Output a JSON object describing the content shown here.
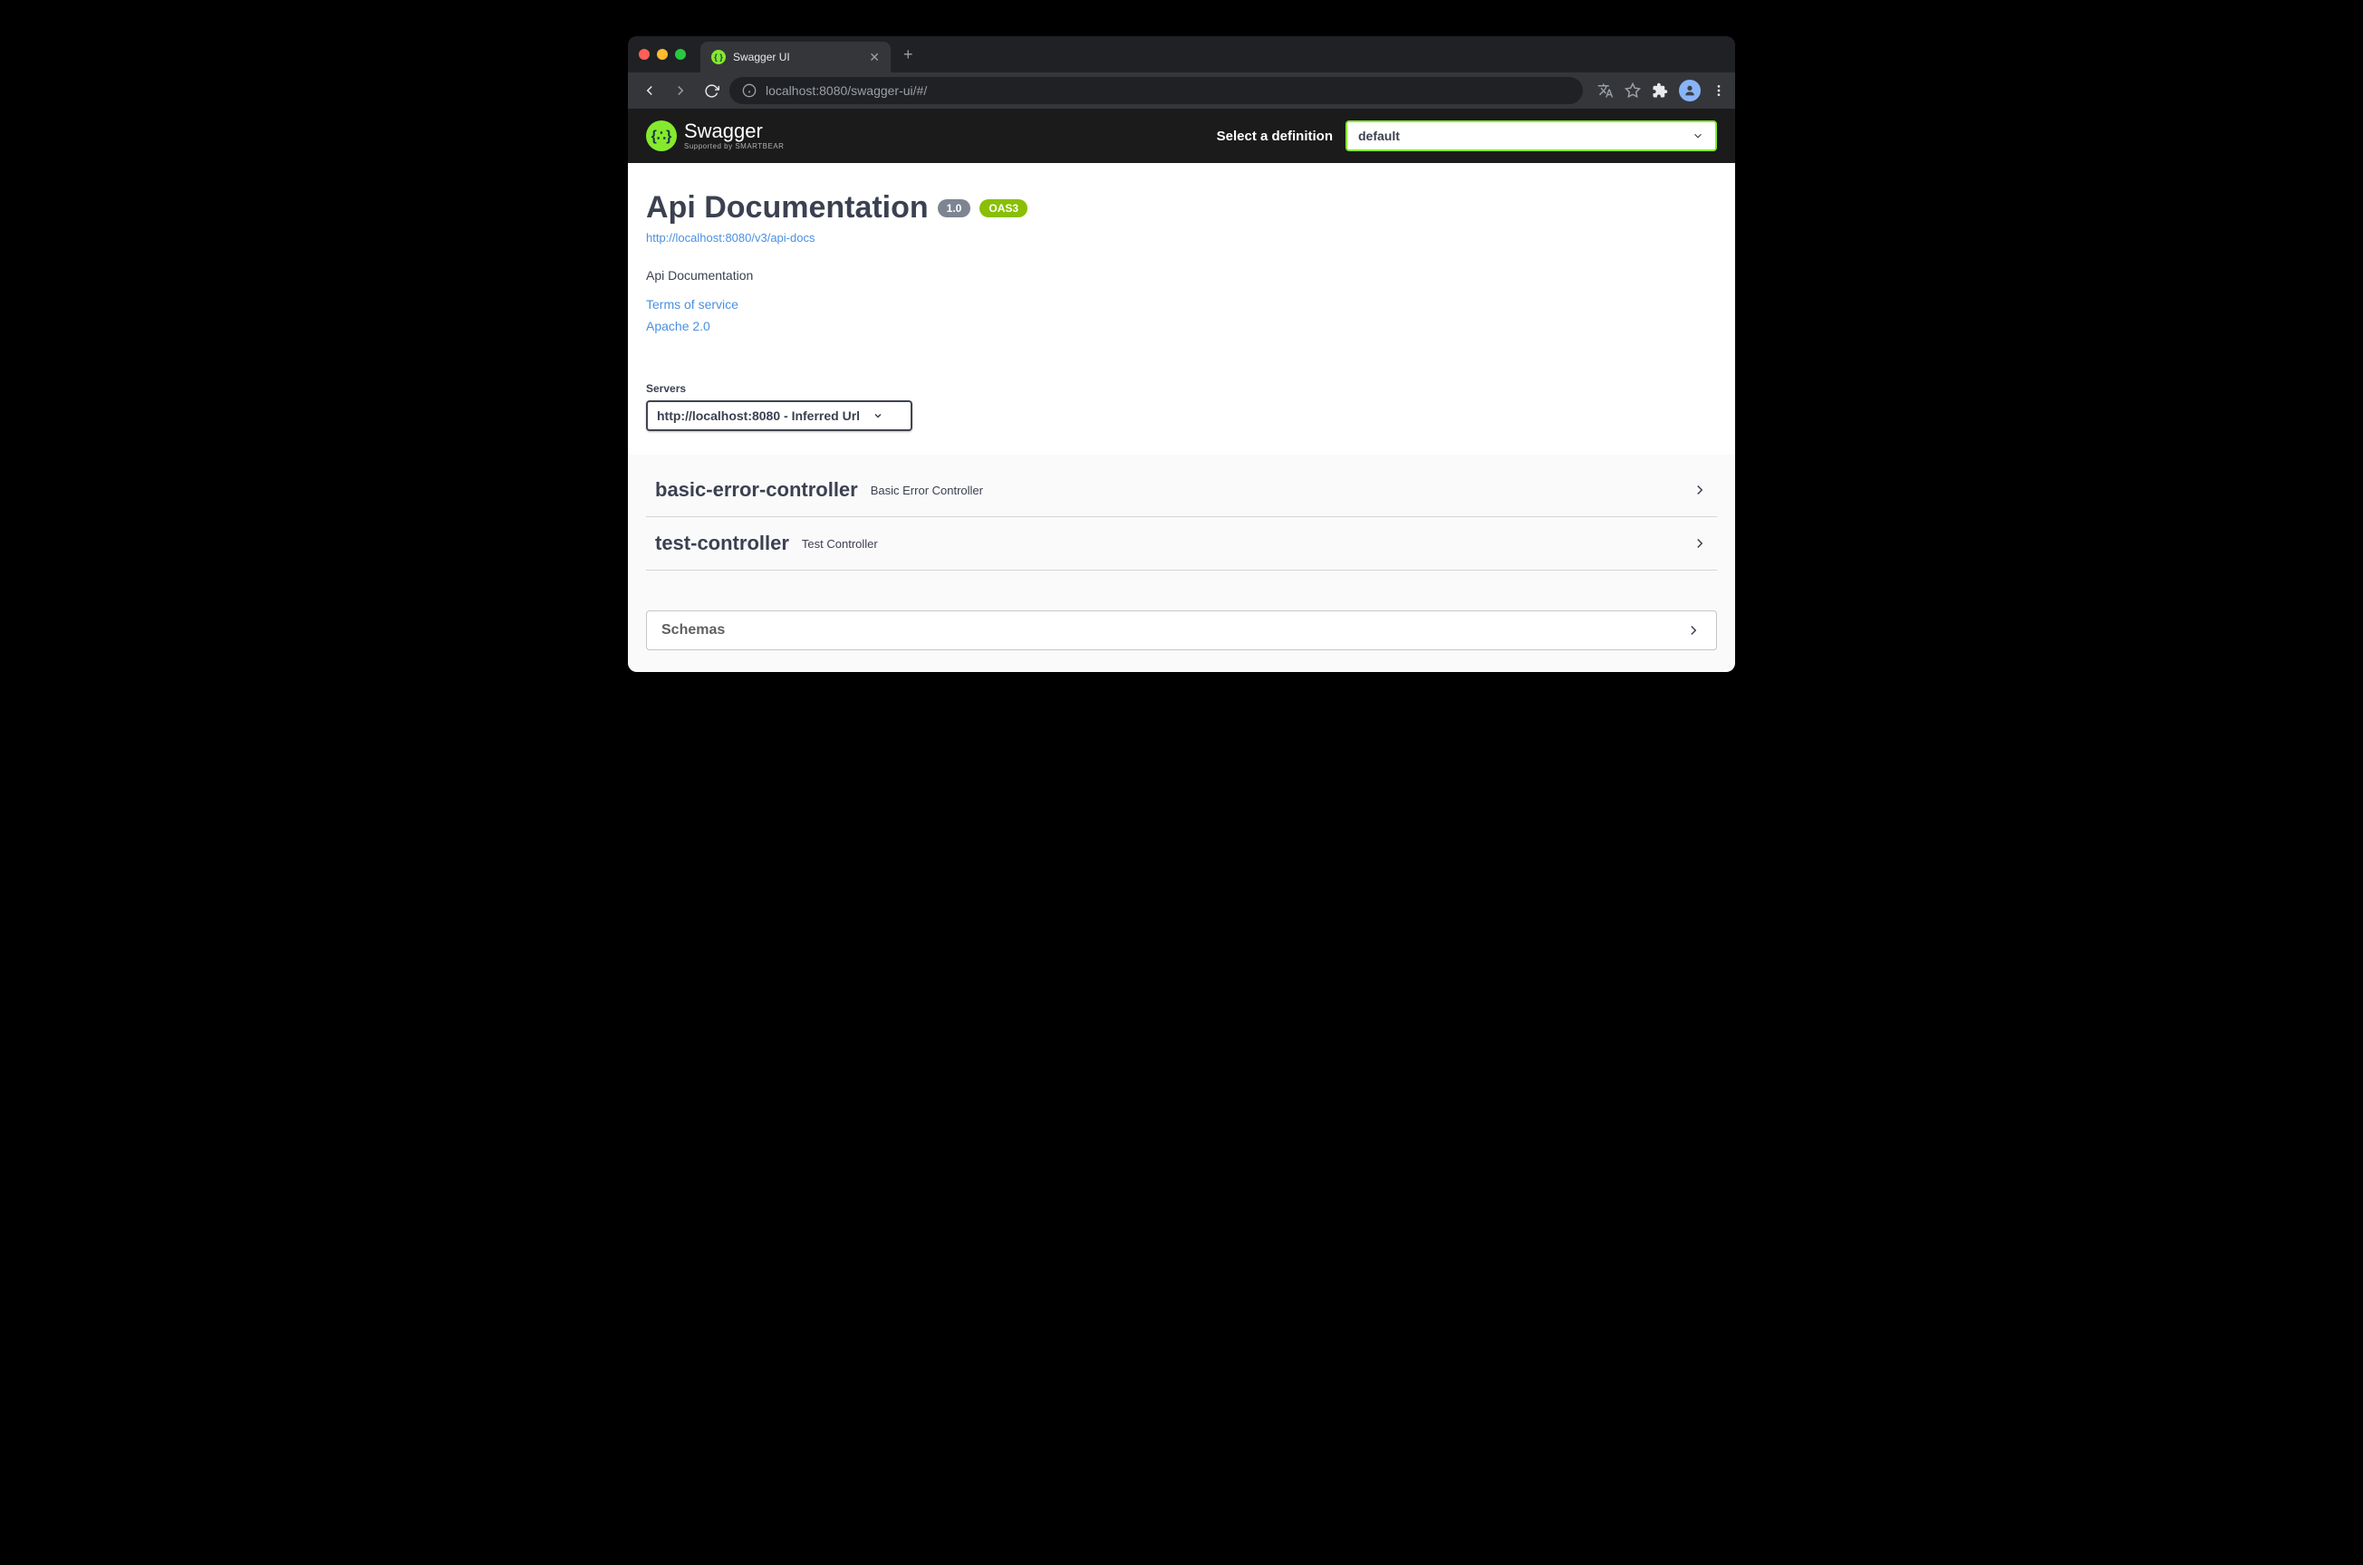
{
  "browser": {
    "tab_title": "Swagger UI",
    "url": "localhost:8080/swagger-ui/#/"
  },
  "topbar": {
    "brand": "Swagger",
    "brand_sub": "Supported by SMARTBEAR",
    "select_label": "Select a definition",
    "definition_value": "default"
  },
  "info": {
    "title": "Api Documentation",
    "version": "1.0",
    "oas": "OAS3",
    "docs_url": "http://localhost:8080/v3/api-docs",
    "description": "Api Documentation",
    "terms_link": "Terms of service",
    "license_link": "Apache 2.0"
  },
  "servers": {
    "label": "Servers",
    "selected": "http://localhost:8080 - Inferred Url"
  },
  "tags": [
    {
      "name": "basic-error-controller",
      "desc": "Basic Error Controller"
    },
    {
      "name": "test-controller",
      "desc": "Test Controller"
    }
  ],
  "schemas": {
    "title": "Schemas"
  }
}
